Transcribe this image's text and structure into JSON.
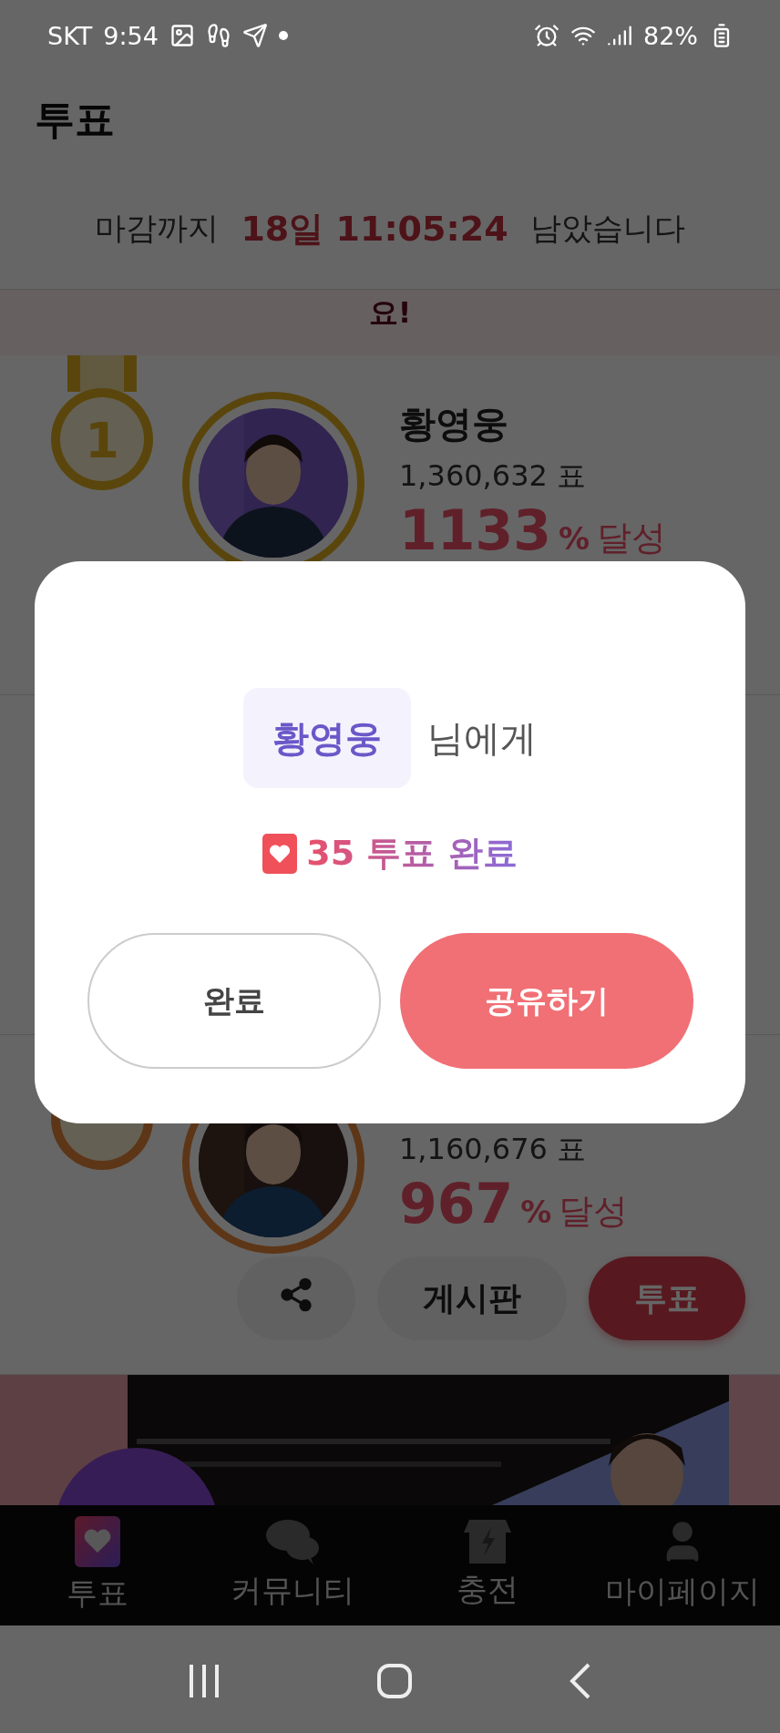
{
  "status_bar": {
    "carrier": "SKT",
    "time": "9:54",
    "battery": "82%"
  },
  "header": {
    "title": "투표"
  },
  "countdown": {
    "prefix": "마감까지",
    "remaining": "18일 11:05:24",
    "suffix": "남았습니다"
  },
  "notice_banner": {
    "text": "요!"
  },
  "rankings": [
    {
      "rank": "1",
      "name": "황영웅",
      "votes": "1,360,632 표",
      "percent": "1133",
      "percent_unit": "%",
      "achieved": "달성"
    },
    {
      "votes": "1,160,676 표",
      "percent": "967",
      "percent_unit": "%",
      "achieved": "달성",
      "actions": {
        "board": "게시판",
        "vote": "투표"
      }
    }
  ],
  "dialog": {
    "recipient": "황영웅",
    "recipient_suffix": "님에게",
    "result": "35 투표 완료",
    "buttons": [
      {
        "kind": "secondary",
        "label": "완료"
      },
      {
        "kind": "primary",
        "label": "공유하기"
      }
    ]
  },
  "bottom_nav": [
    {
      "label": "투표",
      "selected": true
    },
    {
      "label": "커뮤니티",
      "selected": false
    },
    {
      "label": "충전",
      "selected": false
    },
    {
      "label": "마이페이지",
      "selected": false
    }
  ]
}
